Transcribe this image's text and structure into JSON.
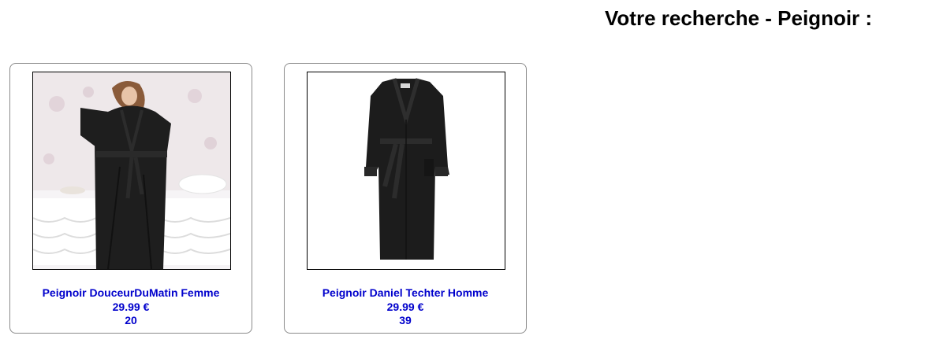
{
  "header": {
    "title": "Votre recherche - Peignoir :"
  },
  "colors": {
    "link": "#0000cc",
    "card_border": "#8a8a8a",
    "robe": "#1e1e1e"
  },
  "products": [
    {
      "image_icon": "woman-bathrobe-photo",
      "name": "Peignoir DouceurDuMatin Femme",
      "price": "29.99 €",
      "quantity": "20"
    },
    {
      "image_icon": "bathrobe-product-photo",
      "name": "Peignoir Daniel Techter Homme",
      "price": "29.99 €",
      "quantity": "39"
    }
  ]
}
